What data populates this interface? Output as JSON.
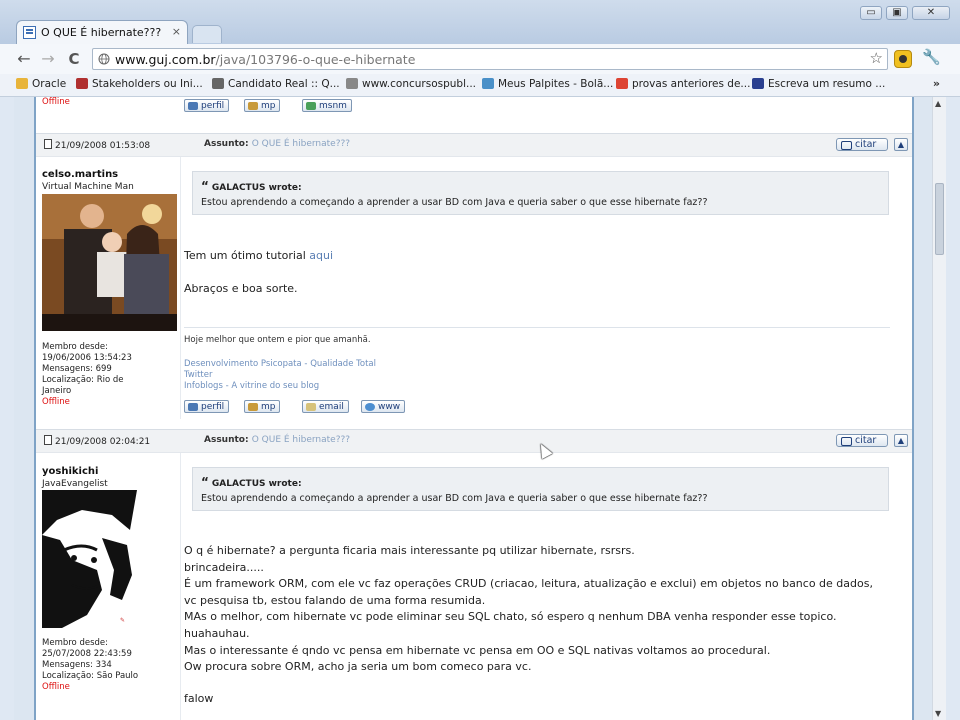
{
  "tab": {
    "title": "O QUE É hibernate???"
  },
  "window": {
    "buttons": [
      "▭",
      "▣",
      "✕"
    ]
  },
  "toolbar": {
    "url_domain": "www.guj.com.br",
    "url_path": "/java/103796-o-que-e-hibernate",
    "back_icon": "←",
    "forward_icon": "→",
    "reload_icon": "C",
    "star_icon": "☆",
    "wrench_icon": "🔧"
  },
  "bookmarks": {
    "items": [
      {
        "label": "Oracle",
        "color": "#e8b43a"
      },
      {
        "label": "Stakeholders ou Ini...",
        "color": "#b03030"
      },
      {
        "label": "Candidato Real :: Q...",
        "color": "#666666"
      },
      {
        "label": "www.concursospubl...",
        "color": "#888888"
      },
      {
        "label": "Meus Palpites - Bolã...",
        "color": "#4a90c8"
      },
      {
        "label": "provas anteriores de...",
        "color": "#dd4433"
      },
      {
        "label": "Escreva um resumo ...",
        "color": "#2a3f8f"
      }
    ],
    "more": "»"
  },
  "top_partial": {
    "status": "Offline",
    "buttons": [
      "perfil",
      "mp",
      "msnm"
    ]
  },
  "posts": [
    {
      "date": "21/09/2008 01:53:08",
      "subject_label": "Assunto:",
      "subject": "O QUE É hibernate???",
      "cite_label": "citar",
      "username": "celso.martins",
      "rank": "Virtual Machine Man",
      "stats": [
        "Membro desde:",
        "19/06/2006 13:54:23",
        "Mensagens: 699",
        "Localização: Rio de",
        "Janeiro"
      ],
      "status": "Offline",
      "quote_author": "GALACTUS wrote:",
      "quote_text": "Estou aprendendo a começando a aprender a usar BD com Java e queria saber o que esse hibernate faz??",
      "body_line1": "Tem um ótimo tutorial",
      "body_link": "aqui",
      "body_line2": "Abraços e boa sorte.",
      "signature": "Hoje melhor que ontem e pior que amanhã.",
      "sig_links": [
        "Desenvolvimento Psicopata - Qualidade Total",
        "Twitter",
        "Infoblogs - A vitrine do seu blog"
      ],
      "buttons": [
        "perfil",
        "mp",
        "email",
        "www"
      ]
    },
    {
      "date": "21/09/2008 02:04:21",
      "subject_label": "Assunto:",
      "subject": "O QUE É hibernate???",
      "cite_label": "citar",
      "username": "yoshikichi",
      "rank": "JavaEvangelist",
      "stats": [
        "Membro desde:",
        "25/07/2008 22:43:59",
        "Mensagens: 334",
        "Localização: São Paulo"
      ],
      "status": "Offline",
      "quote_author": "GALACTUS wrote:",
      "quote_text": "Estou aprendendo a começando a aprender a usar BD com Java e queria saber o que esse hibernate faz??",
      "body_lines": [
        "O q é hibernate? a pergunta ficaria mais interessante pq utilizar hibernate, rsrsrs.",
        "brincadeira.....",
        "É um framework ORM, com ele vc faz operações CRUD (criacao, leitura, atualização e exclui) em objetos no banco de dados,",
        "vc pesquisa tb, estou falando de uma forma resumida.",
        "MAs o melhor, com hibernate vc pode eliminar seu SQL chato, só espero q nenhum DBA venha responder esse topico.",
        "huahauhau.",
        "Mas o interessante é qndo vc pensa em hibernate vc pensa em OO e SQL nativas voltamos ao procedural.",
        "Ow procura sobre ORM, acho ja seria um bom comeco para vc."
      ],
      "body_last": "falow"
    }
  ]
}
